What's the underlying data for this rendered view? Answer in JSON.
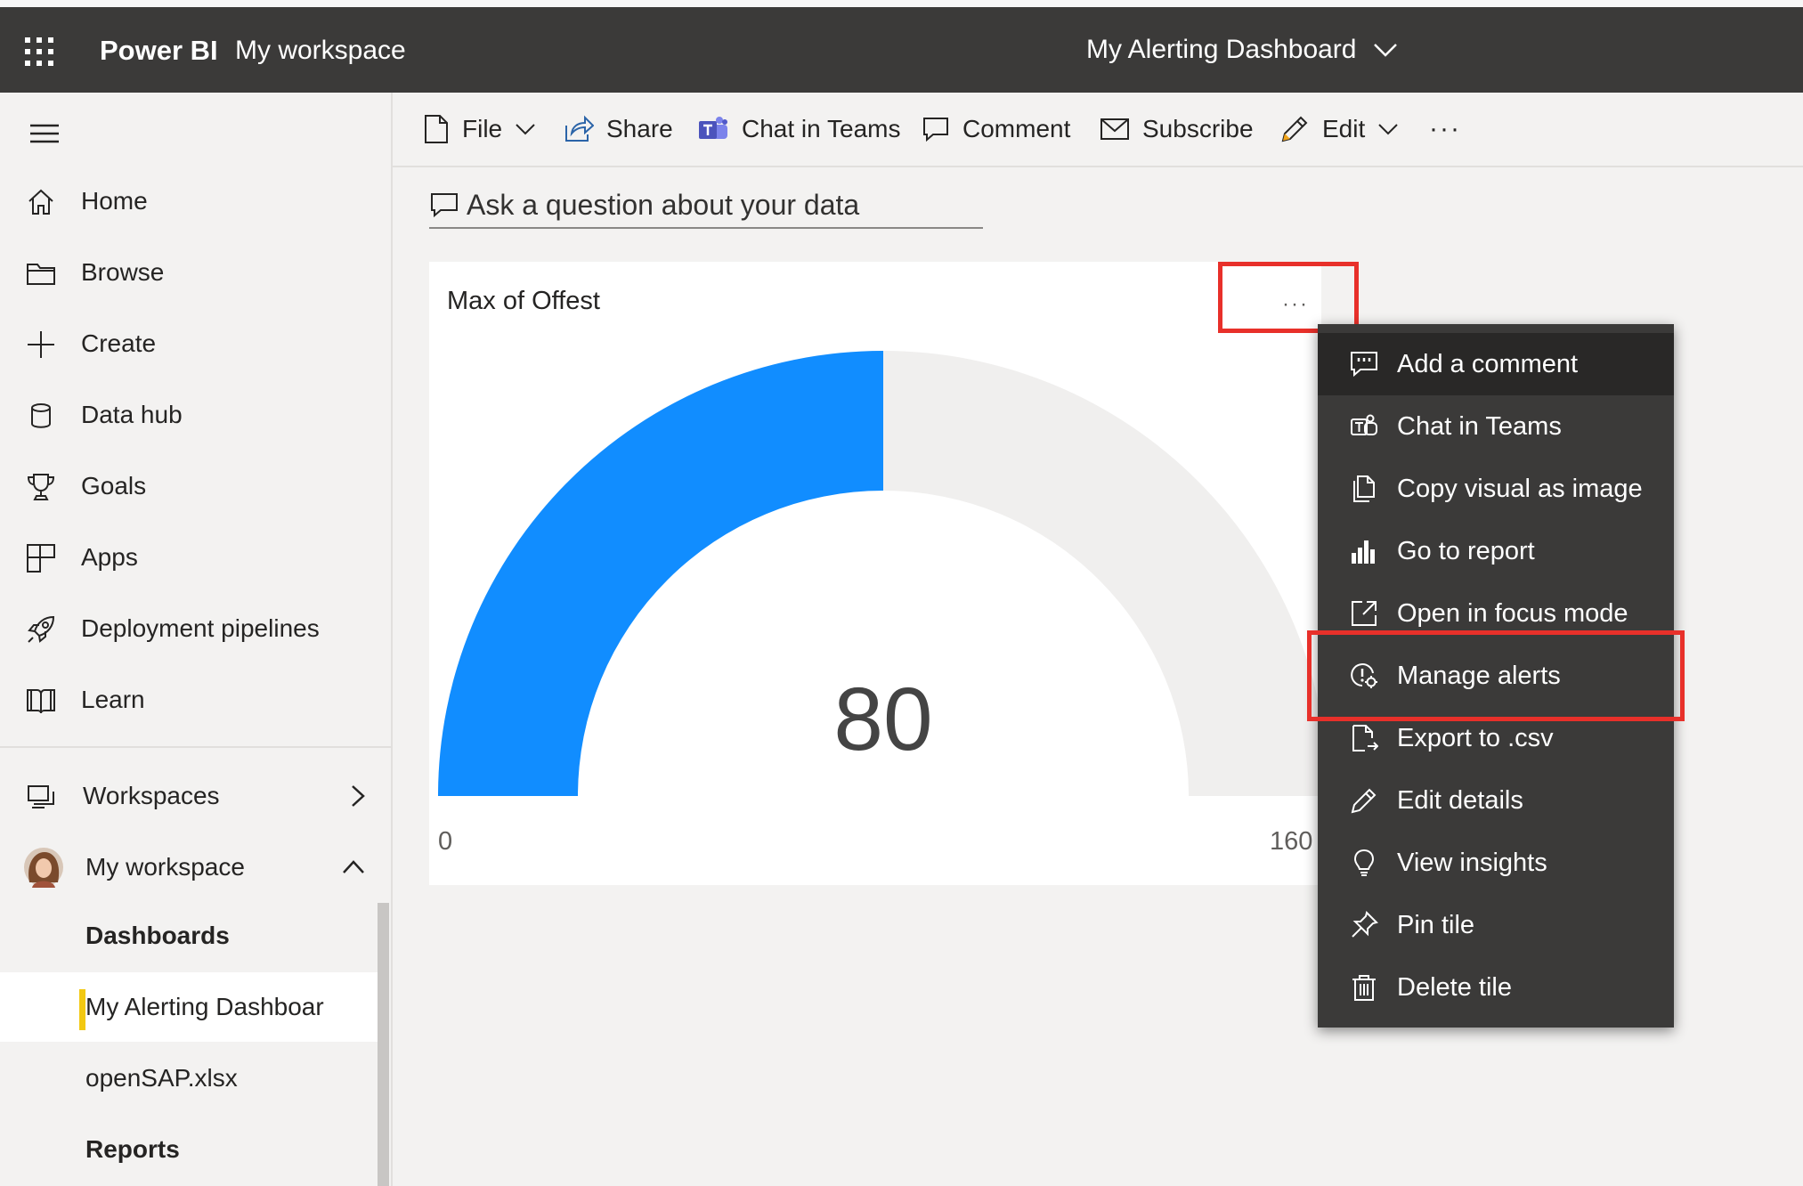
{
  "topbar": {
    "brand": "Power BI",
    "workspace": "My workspace",
    "dashboard_title": "My Alerting Dashboard"
  },
  "nav": {
    "items": [
      {
        "label": "Home",
        "icon": "home-icon"
      },
      {
        "label": "Browse",
        "icon": "folder-icon"
      },
      {
        "label": "Create",
        "icon": "plus-icon"
      },
      {
        "label": "Data hub",
        "icon": "database-icon"
      },
      {
        "label": "Goals",
        "icon": "trophy-icon"
      },
      {
        "label": "Apps",
        "icon": "apps-icon"
      },
      {
        "label": "Deployment pipelines",
        "icon": "rocket-icon"
      },
      {
        "label": "Learn",
        "icon": "book-icon"
      }
    ],
    "workspaces_label": "Workspaces",
    "my_workspace_label": "My workspace",
    "dashboards_header": "Dashboards",
    "dashboard_item": "My Alerting Dashboar",
    "dataset_item": "openSAP.xlsx",
    "reports_header": "Reports"
  },
  "commandbar": {
    "file": "File",
    "share": "Share",
    "chat_in_teams": "Chat in Teams",
    "comment": "Comment",
    "subscribe": "Subscribe",
    "edit": "Edit",
    "more": "···"
  },
  "qa": {
    "placeholder": "Ask a question about your data"
  },
  "tile": {
    "title": "Max of Offest",
    "more": "···",
    "gauge": {
      "value": 80,
      "min": 0,
      "max": 160,
      "value_label": "80",
      "min_label": "0",
      "max_label": "160"
    }
  },
  "menu": {
    "items": [
      {
        "label": "Add a comment",
        "icon": "comment-icon"
      },
      {
        "label": "Chat in Teams",
        "icon": "teams-icon"
      },
      {
        "label": "Copy visual as image",
        "icon": "copy-icon"
      },
      {
        "label": "Go to report",
        "icon": "bar-chart-icon"
      },
      {
        "label": "Open in focus mode",
        "icon": "focus-mode-icon"
      },
      {
        "label": "Manage alerts",
        "icon": "alert-settings-icon"
      },
      {
        "label": "Export to .csv",
        "icon": "export-icon"
      },
      {
        "label": "Edit details",
        "icon": "pencil-icon"
      },
      {
        "label": "View insights",
        "icon": "lightbulb-icon"
      },
      {
        "label": "Pin tile",
        "icon": "pin-icon"
      },
      {
        "label": "Delete tile",
        "icon": "trash-icon"
      }
    ]
  },
  "colors": {
    "gauge_fill": "#118dff",
    "gauge_track": "#f0efee",
    "highlight": "#e8302a",
    "topbar": "#3b3a39",
    "menu_bg": "#3b3a39",
    "selected_marker": "#f2c811"
  }
}
